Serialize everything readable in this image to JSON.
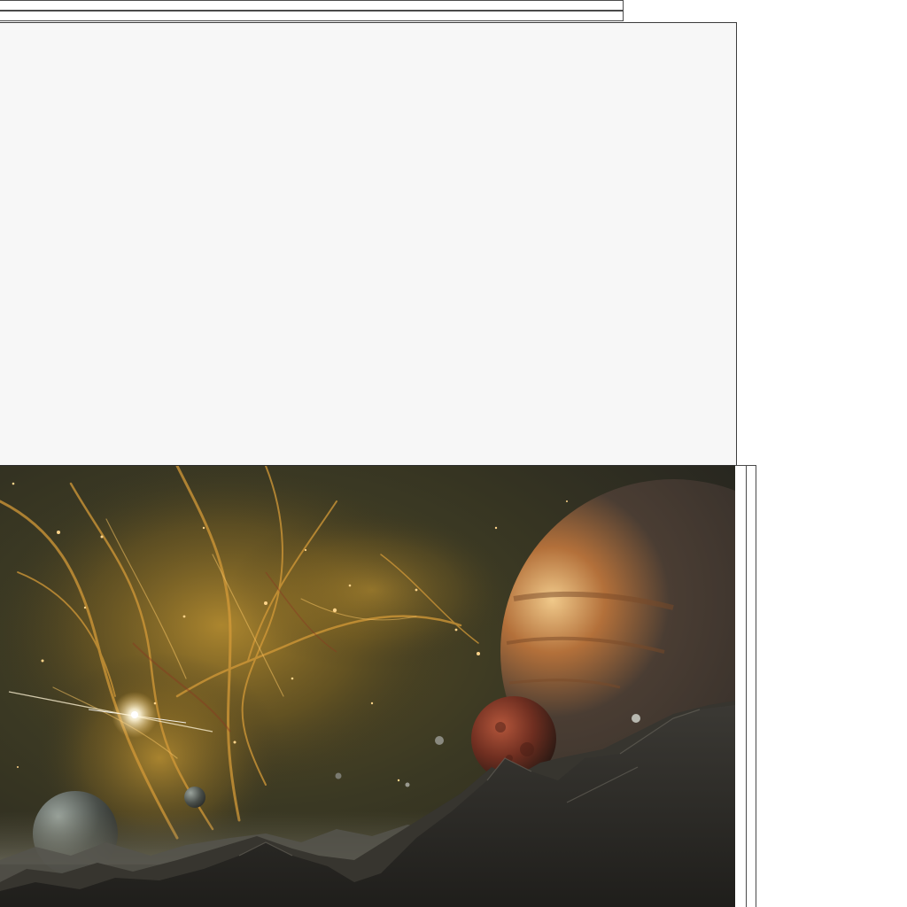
{
  "image": {
    "subject": "space-landscape",
    "colors": {
      "sky_dark": "#2b2a1f",
      "nebula": "#b08a2a",
      "nebula_glow": "#e0a53a",
      "planet_lit": "#d9b07a",
      "planet_shadow": "#3a342c",
      "moon_red": "#8a3b2a",
      "mountains": "#2f2d29",
      "panel_bg": "#f7f7f7"
    }
  }
}
